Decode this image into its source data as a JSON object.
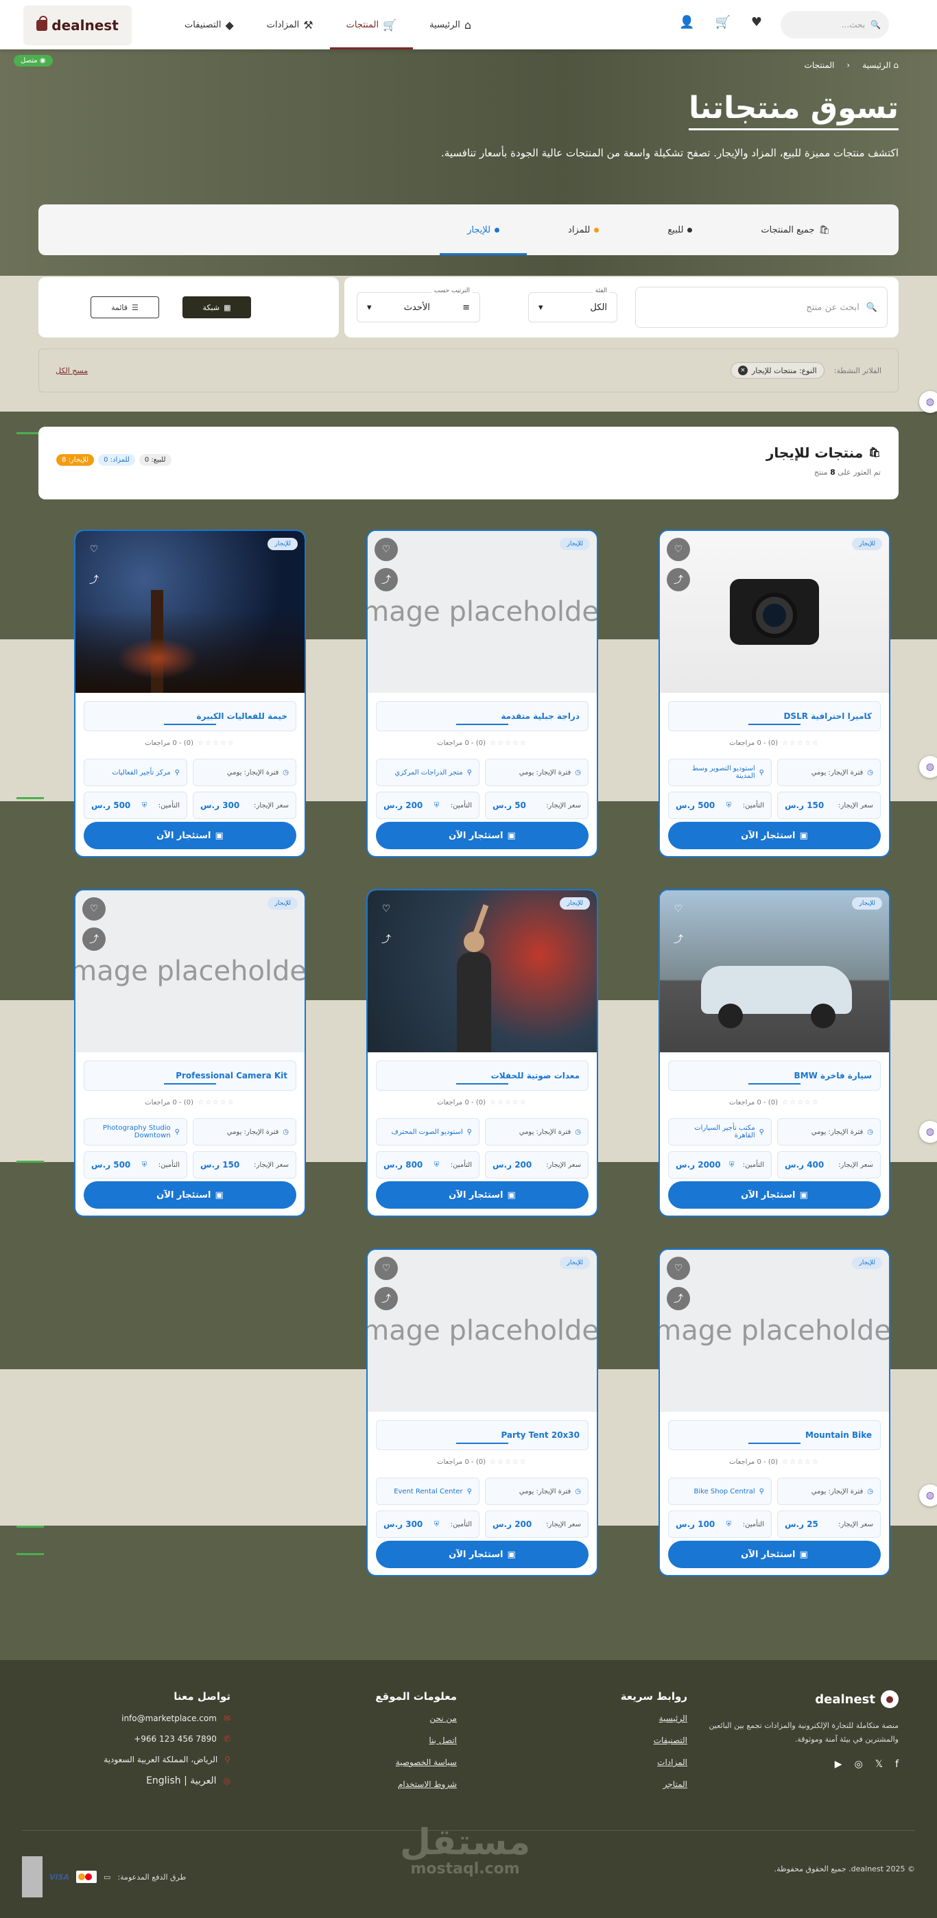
{
  "header": {
    "logo": "dealnest",
    "nav": [
      {
        "label": "الرئيسية",
        "icon": "home-icon",
        "active": false
      },
      {
        "label": "المنتجات",
        "icon": "cart-icon",
        "active": true
      },
      {
        "label": "المزادات",
        "icon": "gavel-icon",
        "active": false
      },
      {
        "label": "التصنيفات",
        "icon": "category-icon",
        "active": false
      }
    ],
    "search_placeholder": "بحث..."
  },
  "status": {
    "online": "متصل"
  },
  "breadcrumb": {
    "home": "الرئيسية",
    "current": "المنتجات"
  },
  "hero": {
    "title": "تسوق منتجاتنا",
    "subtitle": "اكتشف منتجات مميزة للبيع، المزاد والإيجار. تصفح تشكيلة واسعة من المنتجات عالية الجودة بأسعار تنافسية."
  },
  "tabs": [
    {
      "label": "جميع المنتجات",
      "active": false
    },
    {
      "label": "للبيع",
      "active": false,
      "dot": "#333333"
    },
    {
      "label": "للمزاد",
      "active": false,
      "dot": "#f39c12"
    },
    {
      "label": "للإيجار",
      "active": true,
      "dot": "#1976d2"
    }
  ],
  "filters": {
    "search_placeholder": "ابحث عن منتج",
    "category_label": "الفئة",
    "category_value": "الكل",
    "sort_label": "الترتيب حسب",
    "sort_value": "الأحدث",
    "view_grid": "شبكة",
    "view_list": "قائمة",
    "active_label": "الفلاتر النشطة:",
    "active_chip": "النوع: منتجات للإيجار",
    "clear_all": "مسح الكل"
  },
  "section": {
    "title": "منتجات للإيجار",
    "subtitle_pre": "تم العثور على",
    "count": "8",
    "subtitle_post": "منتج",
    "badge_sale": "للبيع: 0",
    "badge_auction": "للمزاد: 0",
    "badge_rent": "للإيجار: 8"
  },
  "card_labels": {
    "tag": "للإيجار",
    "reviews": "(0) - 0 مراجعات",
    "period": "فترة الإيجار: يومي",
    "rent_price": "سعر الإيجار:",
    "deposit": "التأمين:",
    "cta": "استئجار الآن",
    "placeholder": "Image placeholder"
  },
  "products": [
    {
      "title": "كاميرا احترافية DSLR",
      "location": "استوديو التصوير وسط المدينة",
      "rent": "150 ر.س",
      "deposit": "500 ر.س",
      "image": "camera"
    },
    {
      "title": "دراجة جبلية متقدمة",
      "location": "متجر الدراجات المركزي",
      "rent": "50 ر.س",
      "deposit": "200 ر.س",
      "image": "placeholder"
    },
    {
      "title": "خيمة للفعاليات الكبيرة",
      "location": "مركز تأجير الفعاليات",
      "rent": "300 ر.س",
      "deposit": "500 ر.س",
      "image": "forest"
    },
    {
      "title": "سيارة فاخرة BMW",
      "location": "مكتب تأجير السيارات القاهرة",
      "rent": "400 ر.س",
      "deposit": "2000 ر.س",
      "image": "car"
    },
    {
      "title": "معدات صوتية للحفلات",
      "location": "استوديو الصوت المحترف",
      "rent": "200 ر.س",
      "deposit": "800 ر.س",
      "image": "concert"
    },
    {
      "title": "Professional Camera Kit",
      "location": "Photography Studio Downtown",
      "rent": "150 ر.س",
      "deposit": "500 ر.س",
      "image": "placeholder"
    },
    {
      "title": "Mountain Bike",
      "location": "Bike Shop Central",
      "rent": "25 ر.س",
      "deposit": "100 ر.س",
      "image": "placeholder"
    },
    {
      "title": "Party Tent 20x30",
      "location": "Event Rental Center",
      "rent": "200 ر.س",
      "deposit": "300 ر.س",
      "image": "placeholder"
    }
  ],
  "footer": {
    "brand": "dealnest",
    "about": "منصة متكاملة للتجارة الإلكترونية والمزادات تجمع بين البائعين والمشترين في بيئة آمنة وموثوقة.",
    "quick_title": "روابط سريعة",
    "quick_links": [
      "الرئيسية",
      "التصنيفات",
      "المزادات",
      "المتاجر"
    ],
    "info_title": "معلومات الموقع",
    "info_links": [
      "من نحن",
      "اتصل بنا",
      "سياسة الخصوصية",
      "شروط الاستخدام"
    ],
    "contact_title": "تواصل معنا",
    "email": "info@marketplace.com",
    "phone": "+966 123 456 7890",
    "address": "الرياض، المملكة العربية السعودية",
    "lang": "العربية | English",
    "copyright": "© 2025 dealnest. جميع الحقوق محفوظة.",
    "payments_label": "طرق الدفع المدعومة:",
    "visa": "VISA",
    "watermark": "مستقل",
    "watermark_sub": "mostaql.com"
  },
  "colors": {
    "brand": "#7a2a2a",
    "accent": "#1976d2",
    "olive": "#5b6049",
    "success": "#4caf50"
  }
}
